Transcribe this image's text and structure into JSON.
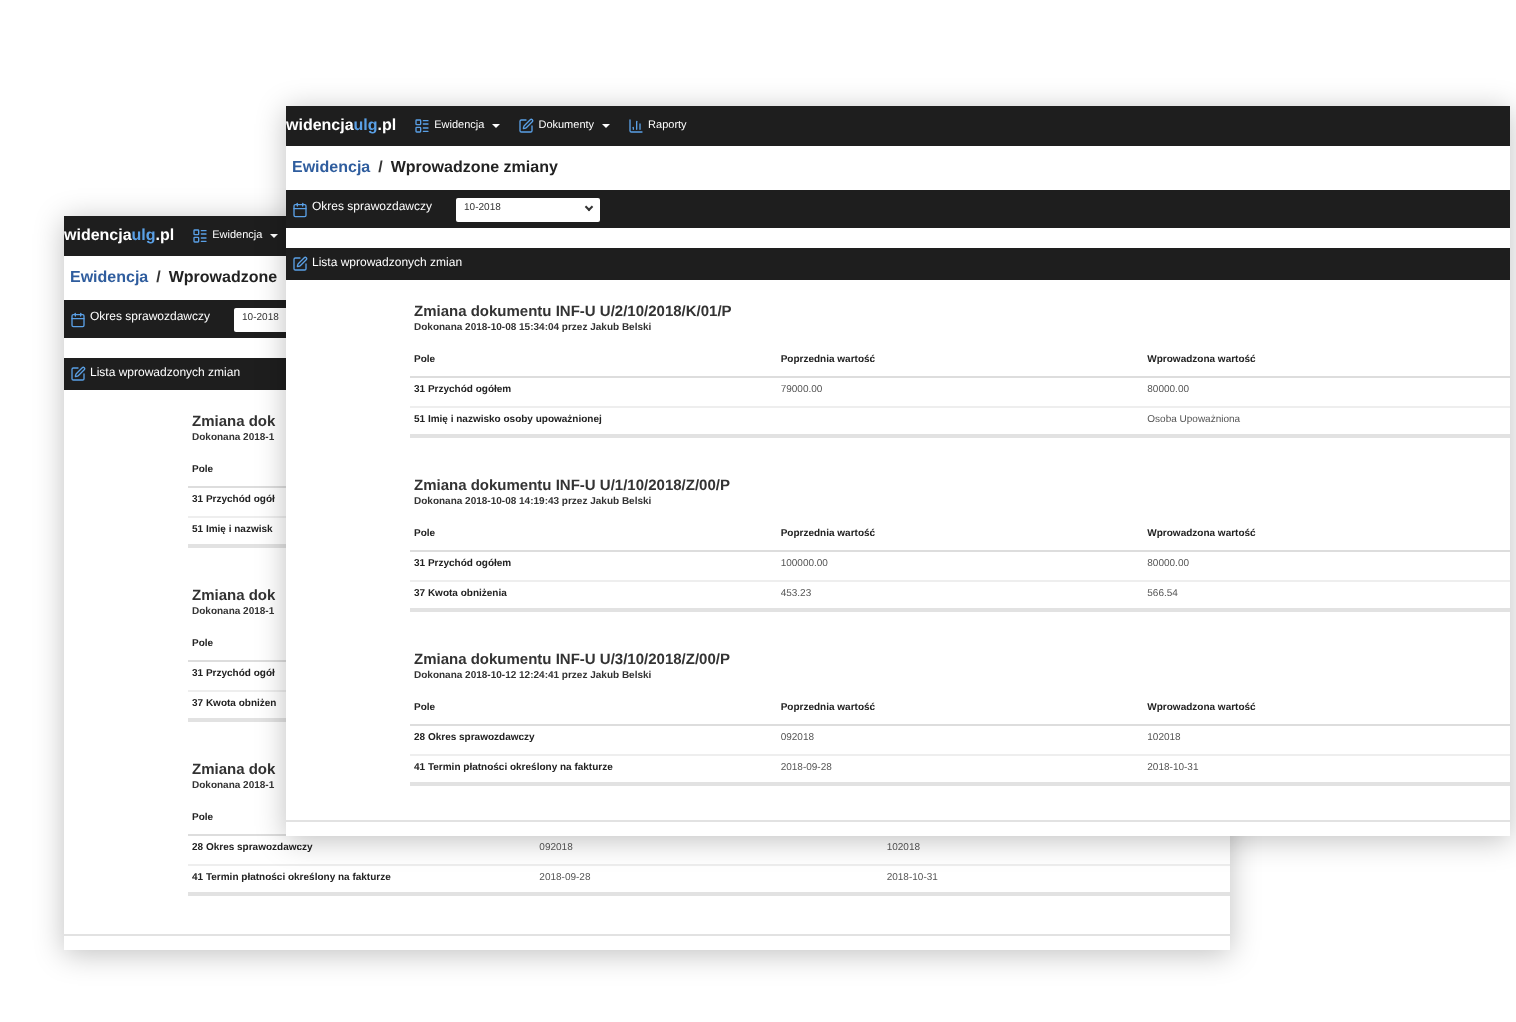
{
  "screens": [
    {
      "brand": {
        "prefix": "widencja",
        "accent": "ulg",
        "suffix": ".pl"
      },
      "nav": [
        {
          "label": "Ewidencja",
          "dropdown": true,
          "kind": "list"
        }
      ],
      "breadcrumb": {
        "parent": "Ewidencja",
        "separator": "/",
        "current": "Wprowadzone"
      },
      "period": {
        "label": "Okres sprawozdawczy",
        "value": "10-2018"
      },
      "list_title": "Lista wprowadzonych zmian",
      "changes": [
        {
          "title": "Zmiana dok",
          "meta": "Dokonana 2018-1",
          "columns": [
            "Pole"
          ],
          "rows": [
            {
              "field": "31 Przychód ogół"
            },
            {
              "field": "51 Imię i nazwisk"
            }
          ]
        },
        {
          "title": "Zmiana dok",
          "meta": "Dokonana 2018-1",
          "columns": [
            "Pole"
          ],
          "rows": [
            {
              "field": "31 Przychód ogół"
            },
            {
              "field": "37 Kwota obniżen"
            }
          ]
        },
        {
          "title": "Zmiana dok",
          "meta": "Dokonana 2018-1",
          "columns": [
            "Pole"
          ],
          "rows": [
            {
              "field": "28 Okres sprawozdawczy",
              "old": "092018",
              "new": "102018"
            },
            {
              "field": "41 Termin płatności określony na fakturze",
              "old": "2018-09-28",
              "new": "2018-10-31"
            }
          ]
        }
      ]
    },
    {
      "brand": {
        "prefix": "widencja",
        "accent": "ulg",
        "suffix": ".pl"
      },
      "nav": [
        {
          "label": "Ewidencja",
          "dropdown": true,
          "kind": "list"
        },
        {
          "label": "Dokumenty",
          "dropdown": true,
          "kind": "edit"
        },
        {
          "label": "Raporty",
          "dropdown": false,
          "kind": "report"
        }
      ],
      "breadcrumb": {
        "parent": "Ewidencja",
        "separator": "/",
        "current": "Wprowadzone zmiany"
      },
      "period": {
        "label": "Okres sprawozdawczy",
        "value": "10-2018"
      },
      "list_title": "Lista wprowadzonych zmian",
      "changes": [
        {
          "title": "Zmiana dokumentu INF-U U/2/10/2018/K/01/P",
          "meta": "Dokonana 2018-10-08 15:34:04 przez Jakub Belski",
          "columns": [
            "Pole",
            "Poprzednia wartość",
            "Wprowadzona wartość"
          ],
          "rows": [
            {
              "field": "31 Przychód ogółem",
              "old": "79000.00",
              "new": "80000.00"
            },
            {
              "field": "51 Imię i nazwisko osoby upoważnionej",
              "new": "Osoba Upoważniona"
            }
          ]
        },
        {
          "title": "Zmiana dokumentu INF-U U/1/10/2018/Z/00/P",
          "meta": "Dokonana 2018-10-08 14:19:43 przez Jakub Belski",
          "columns": [
            "Pole",
            "Poprzednia wartość",
            "Wprowadzona wartość"
          ],
          "rows": [
            {
              "field": "31 Przychód ogółem",
              "old": "100000.00",
              "new": "80000.00"
            },
            {
              "field": "37 Kwota obniżenia",
              "old": "453.23",
              "new": "566.54"
            }
          ]
        },
        {
          "title": "Zmiana dokumentu INF-U U/3/10/2018/Z/00/P",
          "meta": "Dokonana 2018-10-12 12:24:41 przez Jakub Belski",
          "columns": [
            "Pole",
            "Poprzednia wartość",
            "Wprowadzona wartość"
          ],
          "rows": [
            {
              "field": "28 Okres sprawozdawczy",
              "old": "092018",
              "new": "102018"
            },
            {
              "field": "41 Termin płatności określony na fakturze",
              "old": "2018-09-28",
              "new": "2018-10-31"
            }
          ]
        }
      ]
    }
  ]
}
